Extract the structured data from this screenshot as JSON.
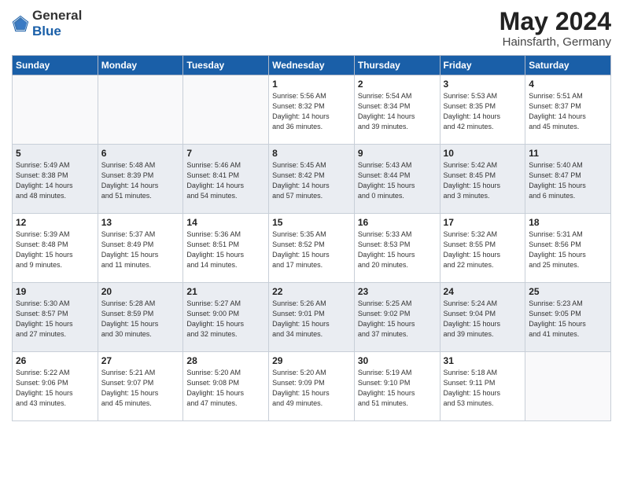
{
  "header": {
    "logo_general": "General",
    "logo_blue": "Blue",
    "title": "May 2024",
    "location": "Hainsfarth, Germany"
  },
  "columns": [
    "Sunday",
    "Monday",
    "Tuesday",
    "Wednesday",
    "Thursday",
    "Friday",
    "Saturday"
  ],
  "weeks": [
    [
      {
        "day": "",
        "info": ""
      },
      {
        "day": "",
        "info": ""
      },
      {
        "day": "",
        "info": ""
      },
      {
        "day": "1",
        "info": "Sunrise: 5:56 AM\nSunset: 8:32 PM\nDaylight: 14 hours\nand 36 minutes."
      },
      {
        "day": "2",
        "info": "Sunrise: 5:54 AM\nSunset: 8:34 PM\nDaylight: 14 hours\nand 39 minutes."
      },
      {
        "day": "3",
        "info": "Sunrise: 5:53 AM\nSunset: 8:35 PM\nDaylight: 14 hours\nand 42 minutes."
      },
      {
        "day": "4",
        "info": "Sunrise: 5:51 AM\nSunset: 8:37 PM\nDaylight: 14 hours\nand 45 minutes."
      }
    ],
    [
      {
        "day": "5",
        "info": "Sunrise: 5:49 AM\nSunset: 8:38 PM\nDaylight: 14 hours\nand 48 minutes."
      },
      {
        "day": "6",
        "info": "Sunrise: 5:48 AM\nSunset: 8:39 PM\nDaylight: 14 hours\nand 51 minutes."
      },
      {
        "day": "7",
        "info": "Sunrise: 5:46 AM\nSunset: 8:41 PM\nDaylight: 14 hours\nand 54 minutes."
      },
      {
        "day": "8",
        "info": "Sunrise: 5:45 AM\nSunset: 8:42 PM\nDaylight: 14 hours\nand 57 minutes."
      },
      {
        "day": "9",
        "info": "Sunrise: 5:43 AM\nSunset: 8:44 PM\nDaylight: 15 hours\nand 0 minutes."
      },
      {
        "day": "10",
        "info": "Sunrise: 5:42 AM\nSunset: 8:45 PM\nDaylight: 15 hours\nand 3 minutes."
      },
      {
        "day": "11",
        "info": "Sunrise: 5:40 AM\nSunset: 8:47 PM\nDaylight: 15 hours\nand 6 minutes."
      }
    ],
    [
      {
        "day": "12",
        "info": "Sunrise: 5:39 AM\nSunset: 8:48 PM\nDaylight: 15 hours\nand 9 minutes."
      },
      {
        "day": "13",
        "info": "Sunrise: 5:37 AM\nSunset: 8:49 PM\nDaylight: 15 hours\nand 11 minutes."
      },
      {
        "day": "14",
        "info": "Sunrise: 5:36 AM\nSunset: 8:51 PM\nDaylight: 15 hours\nand 14 minutes."
      },
      {
        "day": "15",
        "info": "Sunrise: 5:35 AM\nSunset: 8:52 PM\nDaylight: 15 hours\nand 17 minutes."
      },
      {
        "day": "16",
        "info": "Sunrise: 5:33 AM\nSunset: 8:53 PM\nDaylight: 15 hours\nand 20 minutes."
      },
      {
        "day": "17",
        "info": "Sunrise: 5:32 AM\nSunset: 8:55 PM\nDaylight: 15 hours\nand 22 minutes."
      },
      {
        "day": "18",
        "info": "Sunrise: 5:31 AM\nSunset: 8:56 PM\nDaylight: 15 hours\nand 25 minutes."
      }
    ],
    [
      {
        "day": "19",
        "info": "Sunrise: 5:30 AM\nSunset: 8:57 PM\nDaylight: 15 hours\nand 27 minutes."
      },
      {
        "day": "20",
        "info": "Sunrise: 5:28 AM\nSunset: 8:59 PM\nDaylight: 15 hours\nand 30 minutes."
      },
      {
        "day": "21",
        "info": "Sunrise: 5:27 AM\nSunset: 9:00 PM\nDaylight: 15 hours\nand 32 minutes."
      },
      {
        "day": "22",
        "info": "Sunrise: 5:26 AM\nSunset: 9:01 PM\nDaylight: 15 hours\nand 34 minutes."
      },
      {
        "day": "23",
        "info": "Sunrise: 5:25 AM\nSunset: 9:02 PM\nDaylight: 15 hours\nand 37 minutes."
      },
      {
        "day": "24",
        "info": "Sunrise: 5:24 AM\nSunset: 9:04 PM\nDaylight: 15 hours\nand 39 minutes."
      },
      {
        "day": "25",
        "info": "Sunrise: 5:23 AM\nSunset: 9:05 PM\nDaylight: 15 hours\nand 41 minutes."
      }
    ],
    [
      {
        "day": "26",
        "info": "Sunrise: 5:22 AM\nSunset: 9:06 PM\nDaylight: 15 hours\nand 43 minutes."
      },
      {
        "day": "27",
        "info": "Sunrise: 5:21 AM\nSunset: 9:07 PM\nDaylight: 15 hours\nand 45 minutes."
      },
      {
        "day": "28",
        "info": "Sunrise: 5:20 AM\nSunset: 9:08 PM\nDaylight: 15 hours\nand 47 minutes."
      },
      {
        "day": "29",
        "info": "Sunrise: 5:20 AM\nSunset: 9:09 PM\nDaylight: 15 hours\nand 49 minutes."
      },
      {
        "day": "30",
        "info": "Sunrise: 5:19 AM\nSunset: 9:10 PM\nDaylight: 15 hours\nand 51 minutes."
      },
      {
        "day": "31",
        "info": "Sunrise: 5:18 AM\nSunset: 9:11 PM\nDaylight: 15 hours\nand 53 minutes."
      },
      {
        "day": "",
        "info": ""
      }
    ]
  ]
}
